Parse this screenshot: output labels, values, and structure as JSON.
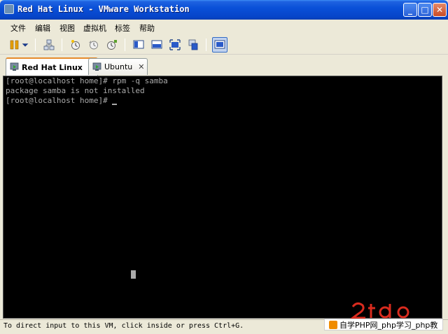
{
  "window": {
    "title": "Red Hat Linux - VMware Workstation",
    "buttons": {
      "minimize": "_",
      "maximize": "□",
      "close": "✕"
    }
  },
  "menu": {
    "items": [
      {
        "label": "文件"
      },
      {
        "label": "编辑"
      },
      {
        "label": "视图"
      },
      {
        "label": "虚拟机"
      },
      {
        "label": "标签"
      },
      {
        "label": "帮助"
      }
    ]
  },
  "toolbar": {
    "icons": [
      "pause-icon",
      "dropdown-icon",
      "network-icon",
      "snapshot-icon",
      "revert-icon",
      "snapshot-manager-icon",
      "console-view-icon",
      "quick-switch-icon",
      "full-screen-icon",
      "unity-icon",
      "thumbnail-view-icon"
    ]
  },
  "tabs": [
    {
      "label": "Red Hat Linux",
      "close": "✕",
      "active": true
    },
    {
      "label": "Ubuntu",
      "close": "✕",
      "active": false
    }
  ],
  "console": {
    "lines": [
      "[root@localhost home]# rpm -q samba",
      "package samba is not installed",
      "[root@localhost home]# "
    ]
  },
  "status": {
    "text": "To direct input to this VM, click inside or press Ctrl+G."
  },
  "watermark": {
    "strip_text": "自学PHP网_php学习_php教"
  },
  "colors": {
    "title_bar": "#0a50d8",
    "tab_accent": "#e68b2c",
    "console_bg": "#000000",
    "console_fg": "#aaaaaa",
    "watermark_red": "#d92b1e"
  }
}
